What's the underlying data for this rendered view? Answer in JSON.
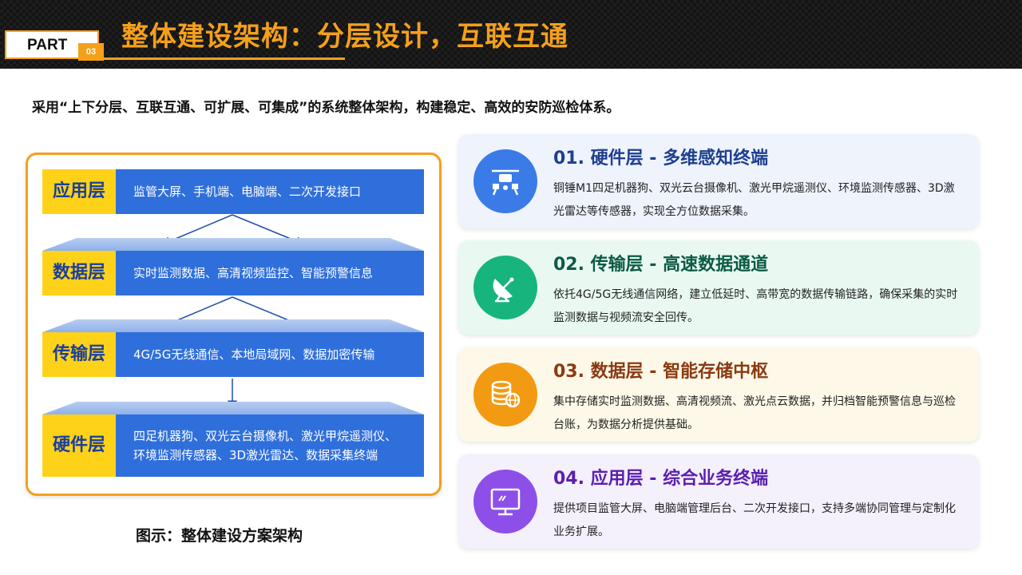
{
  "header": {
    "part_label": "PART",
    "part_number": "03",
    "title": "整体建设架构：分层设计，互联互通",
    "accent_color": "#f5a01a"
  },
  "subtitle": "采用“上下分层、互联互通、可扩展、可集成”的系统整体架构，构建稳定、高效的安防巡检体系。",
  "diagram": {
    "layers": [
      {
        "name": "应用层",
        "content": "监管大屏、手机端、电脑端、二次开发接口"
      },
      {
        "name": "数据层",
        "content": "实时监测数据、高清视频监控、智能预警信息"
      },
      {
        "name": "传输层",
        "content": "4G/5G无线通信、本地局域网、数据加密传输"
      },
      {
        "name": "硬件层",
        "content_line1": "四足机器狗、双光云台摄像机、激光甲烷遥测仪、",
        "content_line2": "环境监测传感器、3D激光雷达、数据采集终端"
      }
    ],
    "caption": "图示：整体建设方案架构"
  },
  "cards": [
    {
      "title": "01. 硬件层 - 多维感知终端",
      "desc": "铜锤M1四足机器狗、双光云台摄像机、激光甲烷遥测仪、环境监测传感器、3D激光雷达等传感器，实现全方位数据采集。",
      "icon": "drone-icon",
      "title_color": "#1f3f8f",
      "bg": "#eef3fc",
      "icon_bg": "#3b7be8"
    },
    {
      "title": "02. 传输层 - 高速数据通道",
      "desc": "依托4G/5G无线通信网络，建立低延时、高带宽的数据传输链路，确保采集的实时监测数据与视频流安全回传。",
      "icon": "satellite-dish-icon",
      "title_color": "#0c5a45",
      "bg": "#e9f9f2",
      "icon_bg": "#17b47e"
    },
    {
      "title": "03. 数据层 - 智能存储中枢",
      "desc": "集中存储实时监测数据、高清视频流、激光点云数据，并归档智能预警信息与巡检台账，为数据分析提供基础。",
      "icon": "database-icon",
      "title_color": "#8a3a12",
      "bg": "#fdf8e8",
      "icon_bg": "#f29a12"
    },
    {
      "title": "04. 应用层 - 综合业务终端",
      "desc": "提供项目监管大屏、电脑端管理后台、二次开发接口，支持多端协同管理与定制化业务扩展。",
      "icon": "monitor-icon",
      "title_color": "#5a1fb0",
      "bg": "#f4f0fc",
      "icon_bg": "#8e4fe8"
    }
  ]
}
